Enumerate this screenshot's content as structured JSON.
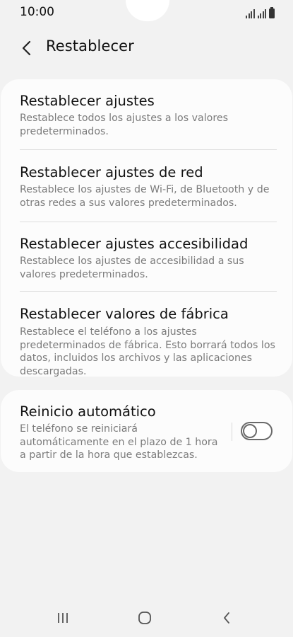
{
  "status_bar": {
    "time": "10:00",
    "icons": [
      "signal-icon",
      "signal-icon",
      "battery-icon"
    ]
  },
  "header": {
    "back_icon": "chevron-left-icon",
    "title": "Restablecer"
  },
  "reset_options": [
    {
      "title": "Restablecer ajustes",
      "description": "Restablece todos los ajustes a los valores predeterminados."
    },
    {
      "title": "Restablecer ajustes de red",
      "description": "Restablece los ajustes de Wi-Fi, de Bluetooth y de otras redes a sus valores predeterminados."
    },
    {
      "title": "Restablecer ajustes accesibilidad",
      "description": "Restablece los ajustes de accesibilidad a sus valores predeterminados."
    },
    {
      "title": "Restablecer valores de fábrica",
      "description": "Restablece el teléfono a los ajustes predeterminados de fábrica. Esto borrará todos los datos, incluidos los archivos y las aplicaciones descargadas."
    }
  ],
  "auto_restart": {
    "title": "Reinicio automático",
    "description": "El teléfono se reiniciará automáticamente en el plazo de 1 hora a partir de la hora que establezcas.",
    "enabled": false
  },
  "nav_bar": {
    "icons": [
      "recents-icon",
      "home-icon",
      "back-icon"
    ]
  },
  "colors": {
    "background": "#f2f2f2",
    "card": "#fcfcfc",
    "title_text": "#111111",
    "secondary_text": "#7b7b7b",
    "divider": "#dcdcdc"
  }
}
